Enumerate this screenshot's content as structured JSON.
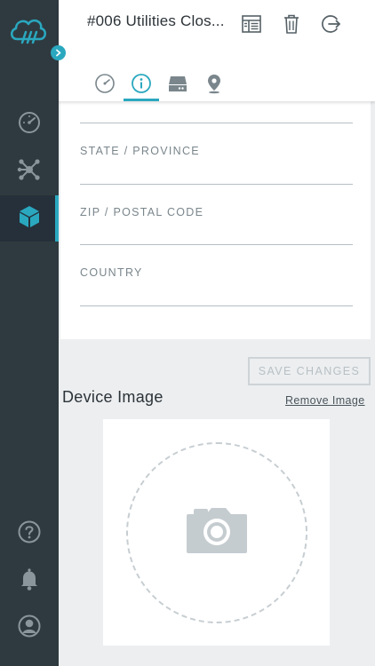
{
  "header": {
    "title": "#006 Utilities Clos..."
  },
  "icons": {
    "logo": "cloud-plug-logo",
    "expand": "chevron-right-icon",
    "sidebar": [
      "speedometer-icon",
      "network-nodes-icon",
      "cube-icon"
    ],
    "sidebar_bottom": [
      "help-icon",
      "bell-icon",
      "user-account-icon"
    ],
    "header": [
      "layout-icon",
      "trash-icon",
      "exit-icon"
    ],
    "tabs": [
      "speedometer-icon",
      "info-icon",
      "storage-icon",
      "location-pin-icon"
    ]
  },
  "form": {
    "fields": [
      {
        "label": "STATE / PROVINCE",
        "value": ""
      },
      {
        "label": "ZIP / POSTAL CODE",
        "value": ""
      },
      {
        "label": "COUNTRY",
        "value": ""
      }
    ],
    "save_label": "SAVE CHANGES"
  },
  "device_image": {
    "title": "Device Image",
    "remove_label": "Remove Image",
    "placeholder_icon": "camera-icon"
  },
  "colors": {
    "accent": "#2aa8bf",
    "sidebar": "#2f3a40",
    "text": "#2c3338"
  }
}
